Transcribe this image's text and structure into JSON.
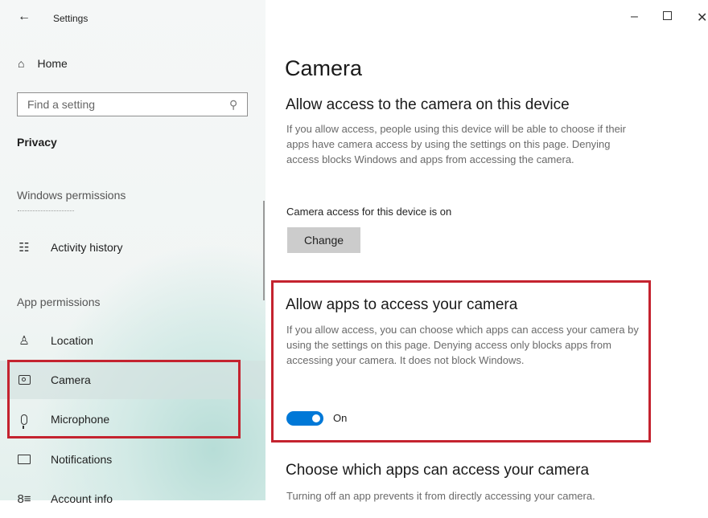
{
  "window": {
    "title": "Settings",
    "back_icon": "←",
    "minimize": "–",
    "close": "✕"
  },
  "sidebar": {
    "home_label": "Home",
    "search": {
      "placeholder": "Find a setting",
      "value": ""
    },
    "category_title": "Privacy",
    "section_windows": "Windows permissions",
    "section_app": "App permissions",
    "items": [
      {
        "label": "Activity history",
        "icon": "activity-history-icon"
      },
      {
        "label": "Location",
        "icon": "location-icon"
      },
      {
        "label": "Camera",
        "icon": "camera-icon",
        "selected": true
      },
      {
        "label": "Microphone",
        "icon": "microphone-icon"
      },
      {
        "label": "Notifications",
        "icon": "notifications-icon"
      },
      {
        "label": "Account info",
        "icon": "account-info-icon"
      }
    ]
  },
  "main": {
    "page_title": "Camera",
    "device_access": {
      "heading": "Allow access to the camera on this device",
      "description": "If you allow access, people using this device will be able to choose if their apps have camera access by using the settings on this page. Denying access blocks Windows and apps from accessing the camera.",
      "status": "Camera access for this device is on",
      "button_label": "Change"
    },
    "app_access": {
      "heading": "Allow apps to access your camera",
      "description": "If you allow access, you can choose which apps can access your camera by using the settings on this page. Denying access only blocks apps from accessing your camera. It does not block Windows.",
      "toggle_state": "On",
      "toggle_on": true
    },
    "choose_apps": {
      "heading": "Choose which apps can access your camera",
      "description": "Turning off an app prevents it from directly accessing your camera."
    }
  },
  "colors": {
    "accent": "#0078d7",
    "highlight": "#c4232f"
  }
}
